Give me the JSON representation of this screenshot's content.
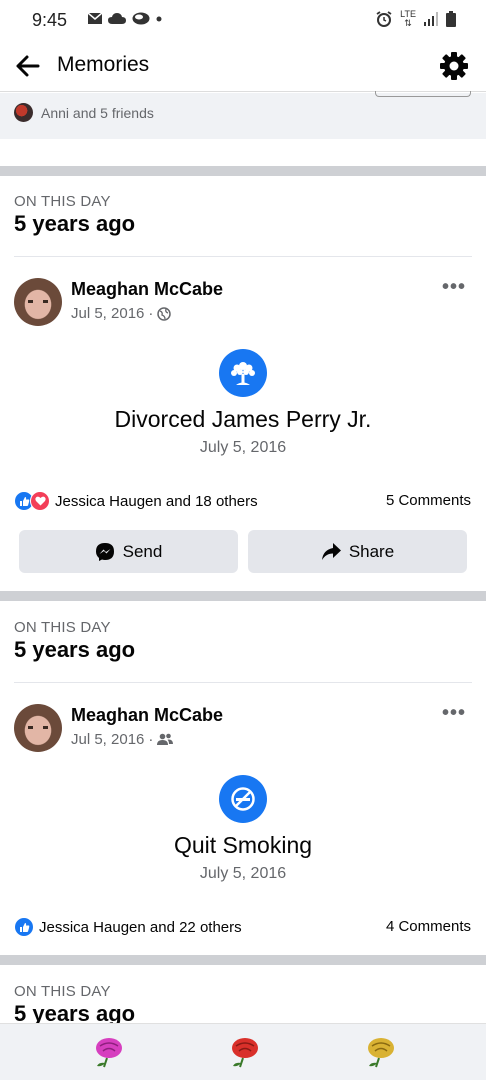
{
  "status_bar": {
    "time": "9:45",
    "network": "LTE",
    "left_icons": [
      "mail-icon",
      "cloud-icon",
      "cloud-alt-icon",
      "dot-icon"
    ],
    "right_icons": [
      "alarm-icon",
      "lte-icon",
      "signal-icon",
      "battery-icon"
    ]
  },
  "header": {
    "title": "Memories",
    "back_icon": "arrow-left-icon",
    "settings_icon": "gear-icon"
  },
  "top_strip": {
    "friends_text": "Anni and 5 friends"
  },
  "memories": [
    {
      "section_label": "ON THIS DAY",
      "heading": "5 years ago",
      "author": "Meaghan McCabe",
      "date": "Jul 5, 2016",
      "audience_icon": "globe-icon",
      "life_event_icon": "tree-icon",
      "life_event_title": "Divorced James Perry Jr.",
      "life_event_date": "July 5, 2016",
      "reactions_text": "Jessica Haugen and 18 others",
      "reaction_types": [
        "like",
        "love"
      ],
      "comments": "5 Comments",
      "send_label": "Send",
      "share_label": "Share"
    },
    {
      "section_label": "ON THIS DAY",
      "heading": "5 years ago",
      "author": "Meaghan McCabe",
      "date": "Jul 5, 2016",
      "audience_icon": "friends-icon",
      "life_event_icon": "no-smoking-icon",
      "life_event_title": "Quit Smoking",
      "life_event_date": "July 5, 2016",
      "reactions_text": "Jessica Haugen and 22 others",
      "reaction_types": [
        "like"
      ],
      "comments": "4 Comments"
    },
    {
      "section_label": "ON THIS DAY",
      "heading": "5 years ago"
    }
  ],
  "bottom_bar": {
    "items": [
      "pink-rose-icon",
      "red-rose-icon",
      "yellow-rose-icon"
    ],
    "colors": [
      "#d63fbf",
      "#d9302a",
      "#d9b233"
    ]
  },
  "colors": {
    "accent": "#1877f2",
    "love": "#f33e58",
    "divider": "#ced0d4",
    "secondary_text": "#65676b"
  }
}
